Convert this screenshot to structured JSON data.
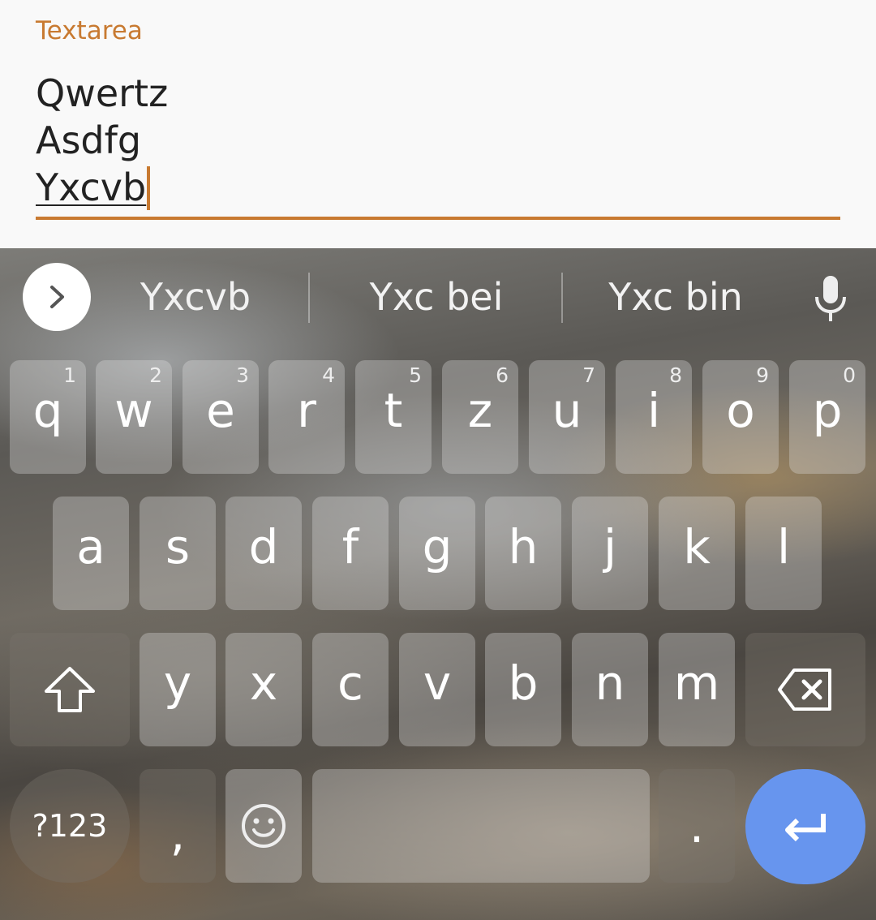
{
  "textarea": {
    "label": "Textarea",
    "lines": [
      "Qwertz",
      "Asdfg",
      "Yxcvb"
    ],
    "accent_color": "#c87a31"
  },
  "keyboard": {
    "suggestions": [
      "Yxcvb",
      "Yxc bei",
      "Yxc bin"
    ],
    "expand_icon": "chevron-right-icon",
    "mic_icon": "microphone-icon",
    "row1": [
      {
        "key": "q",
        "hint": "1"
      },
      {
        "key": "w",
        "hint": "2"
      },
      {
        "key": "e",
        "hint": "3"
      },
      {
        "key": "r",
        "hint": "4"
      },
      {
        "key": "t",
        "hint": "5"
      },
      {
        "key": "z",
        "hint": "6"
      },
      {
        "key": "u",
        "hint": "7"
      },
      {
        "key": "i",
        "hint": "8"
      },
      {
        "key": "o",
        "hint": "9"
      },
      {
        "key": "p",
        "hint": "0"
      }
    ],
    "row2": [
      "a",
      "s",
      "d",
      "f",
      "g",
      "h",
      "j",
      "k",
      "l"
    ],
    "row3": [
      "y",
      "x",
      "c",
      "v",
      "b",
      "n",
      "m"
    ],
    "symbols_key": "?123",
    "comma_key": ",",
    "period_key": ".",
    "enter_color": "#6795ee"
  }
}
